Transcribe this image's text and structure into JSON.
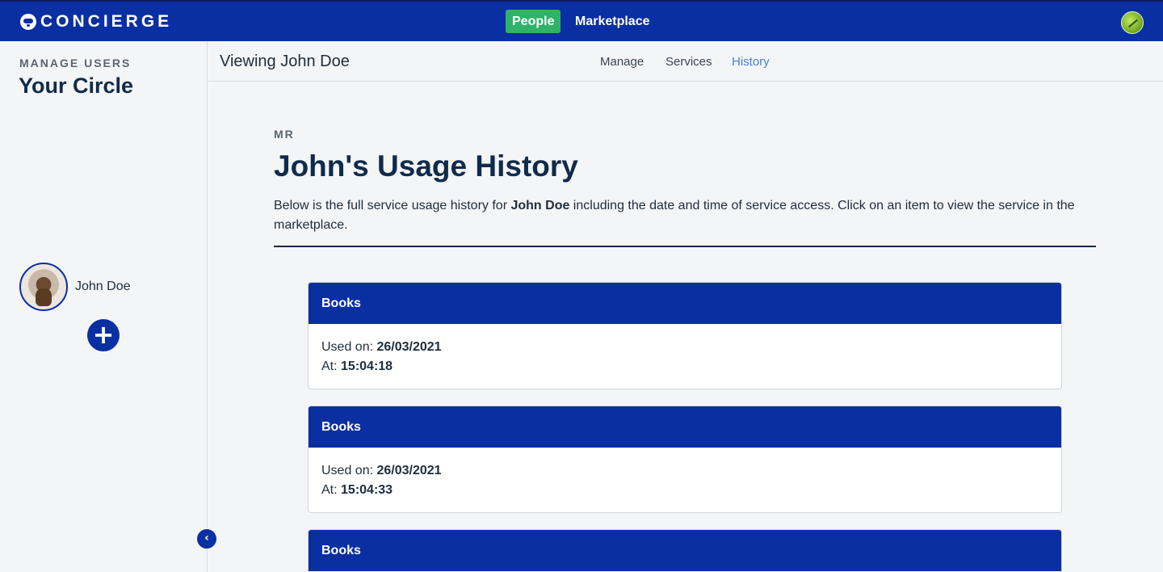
{
  "topbar": {
    "brand": "CONCIERGE",
    "nav": [
      "People",
      "Marketplace"
    ],
    "active_nav": "People",
    "accent_color": "#0a2fa3",
    "active_color": "#2fb36a"
  },
  "sidebar": {
    "eyebrow": "MANAGE USERS",
    "title": "Your Circle",
    "users": [
      {
        "name": "John Doe"
      }
    ]
  },
  "subheader": {
    "viewing": "Viewing John Doe",
    "tabs": [
      "Manage",
      "Services",
      "History"
    ],
    "active_tab": "History"
  },
  "main": {
    "eyebrow": "MR",
    "title": "John's Usage History",
    "description": {
      "before": "Below is the full service usage history for ",
      "name": "John Doe",
      "after": " including the date and time of service access. Click on an item to view the service in the marketplace."
    },
    "used_on_label": "Used on: ",
    "at_label": "At: ",
    "history": [
      {
        "service": "Books",
        "date": "26/03/2021",
        "time": "15:04:18"
      },
      {
        "service": "Books",
        "date": "26/03/2021",
        "time": "15:04:33"
      },
      {
        "service": "Books"
      }
    ]
  }
}
